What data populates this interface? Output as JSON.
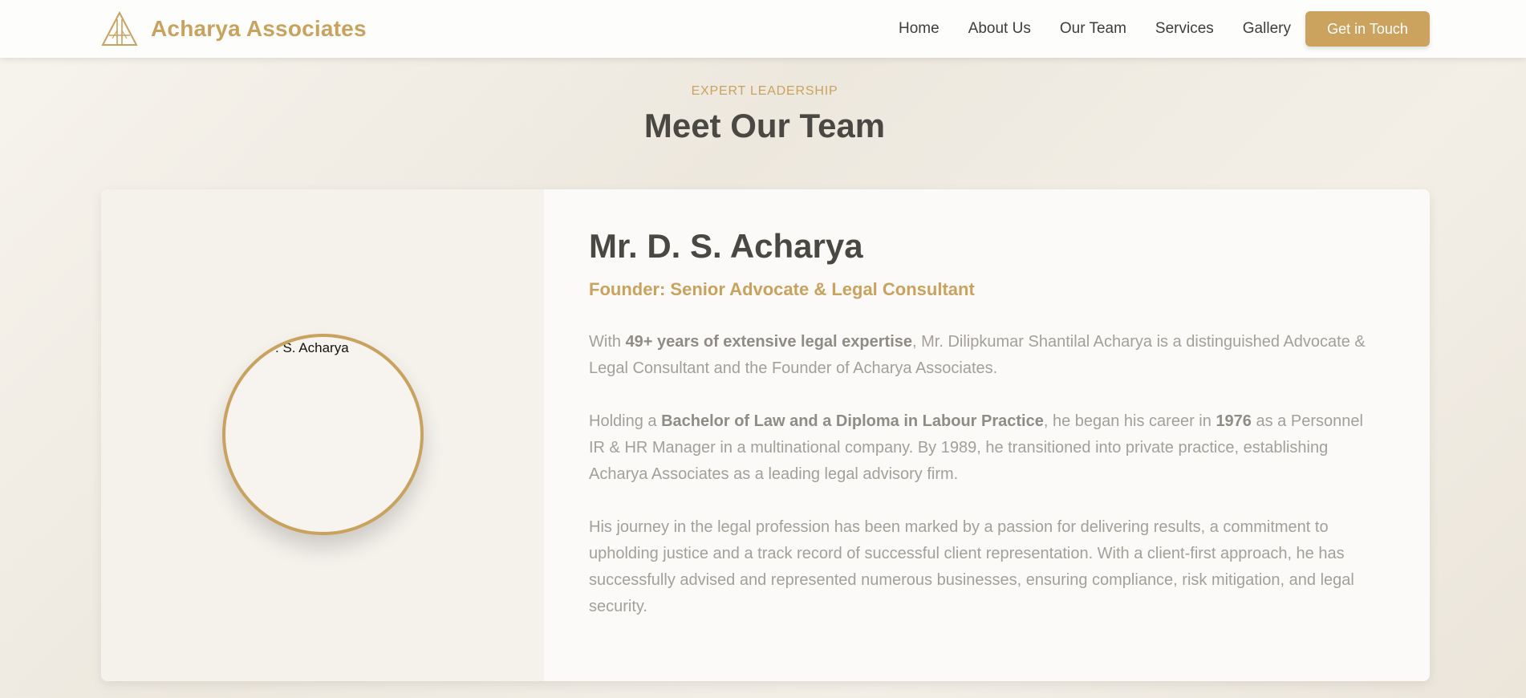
{
  "header": {
    "brand_name": "Acharya Associates",
    "nav_items": [
      "Home",
      "About Us",
      "Our Team",
      "Services",
      "Gallery"
    ],
    "cta_label": "Get in Touch"
  },
  "section": {
    "eyebrow": "EXPERT LEADERSHIP",
    "title": "Meet Our Team"
  },
  "member": {
    "image_alt_text": ". S. Acharya",
    "name": "Mr. D. S. Acharya",
    "role": "Founder: Senior Advocate & Legal Consultant",
    "bio": [
      {
        "t1": "With ",
        "b1": "49+ years of extensive legal expertise",
        "t2": ", Mr. Dilipkumar Shantilal Acharya is a distinguished Advocate & Legal Consultant and the Founder of Acharya Associates."
      },
      {
        "t1": "Holding a ",
        "b1": "Bachelor of Law and a Diploma in Labour Practice",
        "t2": ", he began his career in ",
        "b2": "1976",
        "t3": " as a Personnel IR & HR Manager in a multinational company. By 1989, he transitioned into private practice, establishing Acharya Associates as a leading legal advisory firm."
      },
      {
        "t1": "His journey in the legal profession has been marked by a passion for delivering results, a commitment to upholding justice and a track record of successful client representation. With a client-first approach, he has successfully advised and represented numerous businesses, ensuring compliance, risk mitigation, and legal security."
      }
    ]
  },
  "colors": {
    "accent": "#c9a25d",
    "heading": "#4a4843",
    "body_text": "#a3a09a",
    "header_bg": "#fdfdfc"
  },
  "icons": {
    "logo": "triangle-monogram-icon"
  }
}
